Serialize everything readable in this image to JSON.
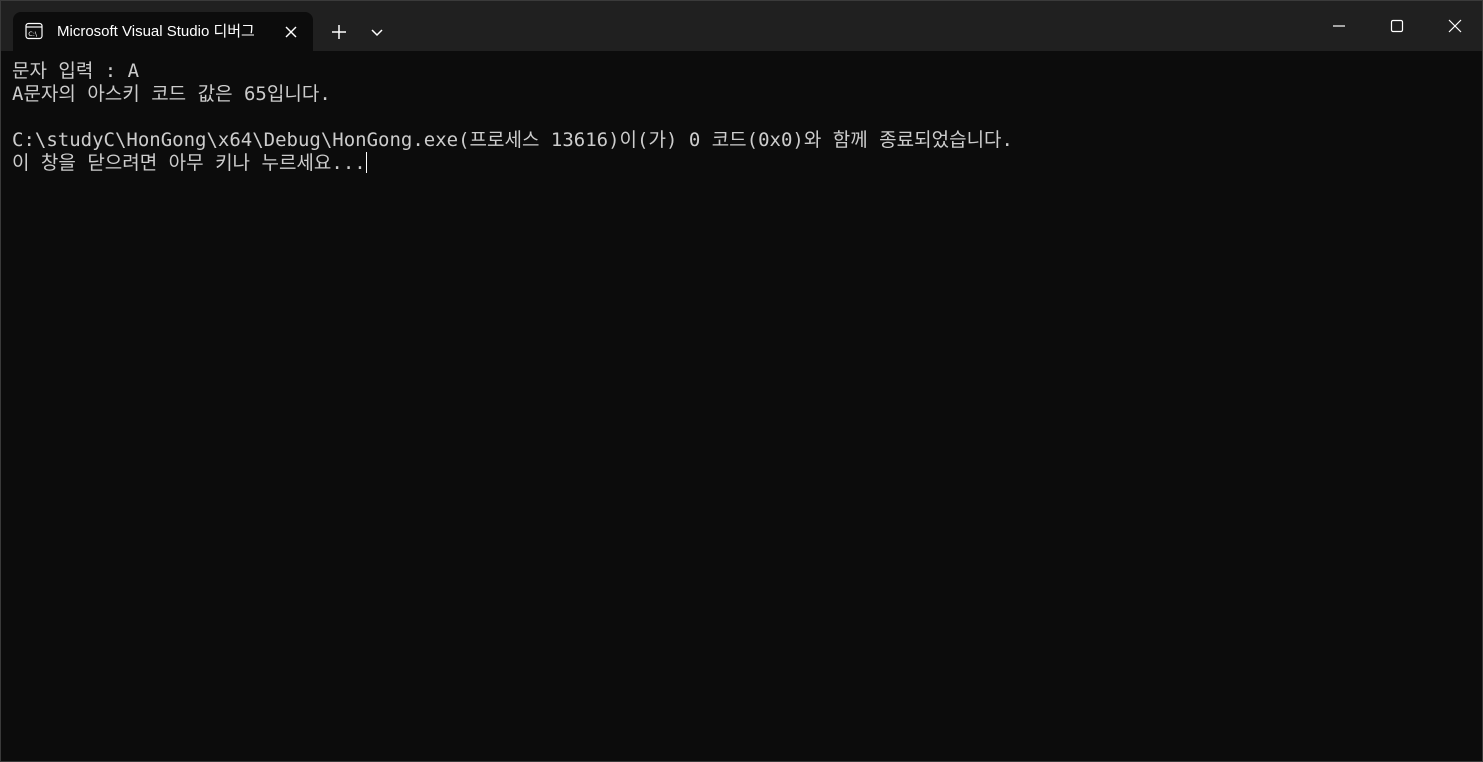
{
  "window": {
    "tab_title": "Microsoft Visual Studio 디버그",
    "tab_icon": "console-icon",
    "accent_bg": "#202020",
    "console_bg": "#0c0c0c",
    "text_color": "#cccccc"
  },
  "titlebar": {
    "new_tab_icon": "plus-icon",
    "dropdown_icon": "chevron-down-icon",
    "minimize_icon": "minimize-icon",
    "maximize_icon": "maximize-icon",
    "close_icon": "close-icon"
  },
  "console": {
    "lines": [
      "문자 입력 : A",
      "A문자의 아스키 코드 값은 65입니다.",
      "",
      "C:\\studyC\\HonGong\\x64\\Debug\\HonGong.exe(프로세스 13616)이(가) 0 코드(0x0)와 함께 종료되었습니다.",
      "이 창을 닫으려면 아무 키나 누르세요..."
    ]
  }
}
